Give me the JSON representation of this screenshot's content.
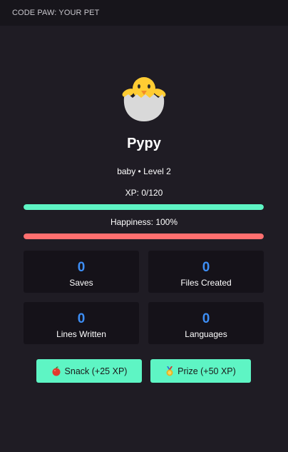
{
  "header": {
    "title": "CODE PAW: YOUR PET"
  },
  "pet": {
    "icon": "hatching-chick-icon",
    "name": "Pypy",
    "stage_line": "baby • Level 2",
    "xp_label": "XP: 0/120",
    "xp_fraction": 1.0,
    "happiness_label": "Happiness: 100%",
    "happiness_fraction": 1.0
  },
  "stats": [
    {
      "value": "0",
      "label": "Saves"
    },
    {
      "value": "0",
      "label": "Files Created"
    },
    {
      "value": "0",
      "label": "Lines Written"
    },
    {
      "value": "0",
      "label": "Languages"
    }
  ],
  "actions": [
    {
      "icon": "apple-icon",
      "label": "Snack (+25 XP)"
    },
    {
      "icon": "medal-icon",
      "label": "Prize (+50 XP)"
    }
  ],
  "colors": {
    "background": "#1f1c24",
    "header_background": "#17151b",
    "card_background": "#151219",
    "xp_bar": "#5ef5c4",
    "happiness_bar": "#ff6f6f",
    "stat_value": "#3d8ef5",
    "button": "#5ef5c4"
  }
}
